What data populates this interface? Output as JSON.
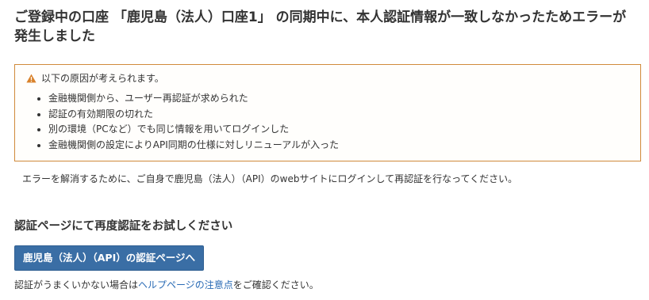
{
  "title": "ご登録中の口座 「鹿児島（法人）口座1」 の同期中に、本人認証情報が一致しなかったためエラーが発生しました",
  "alert": {
    "heading": "以下の原因が考えられます。",
    "reasons": [
      "金融機関側から、ユーザー再認証が求められた",
      "認証の有効期限の切れた",
      "別の環境（PCなど）でも同じ情報を用いてログインした",
      "金融機関側の設定によりAPI同期の仕様に対しリニューアルが入った"
    ],
    "icon": "warning-icon",
    "border_color": "#d08a3a",
    "icon_color": "#d9822b"
  },
  "resolve_text": "エラーを解消するために、ご自身で鹿児島（法人）（API）のwebサイトにログインして再認証を行なってください。",
  "subheading": "認証ページにて再度認証をお試しください",
  "auth_button_label": "鹿児島（法人）（API）の認証ページへ",
  "button_color": "#3a6ea5",
  "note": {
    "prefix": "認証がうまくいかない場合は",
    "link_text": "ヘルプページの注意点",
    "suffix": "をご確認ください。",
    "link_color": "#2a6bb5"
  }
}
